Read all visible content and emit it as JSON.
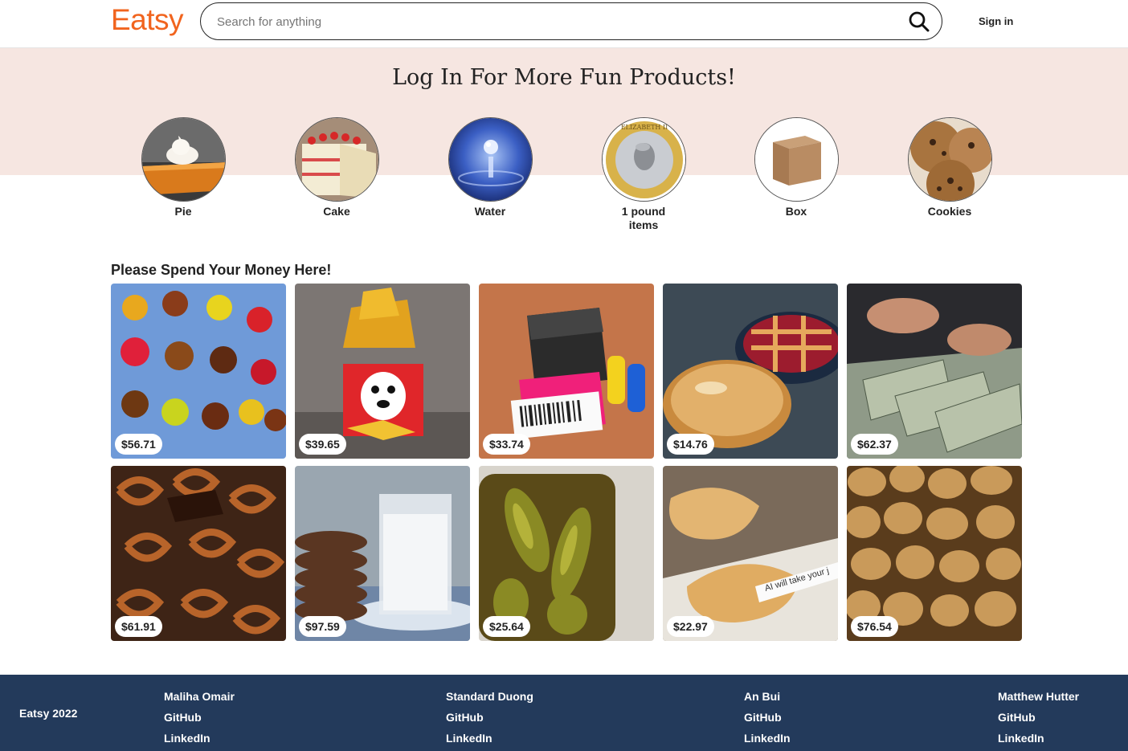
{
  "header": {
    "logo": "Eatsy",
    "search_placeholder": "Search for anything",
    "sign_in": "Sign in"
  },
  "hero": {
    "title": "Log In For More Fun Products!",
    "categories": [
      {
        "label": "Pie",
        "image": "pie-image"
      },
      {
        "label": "Cake",
        "image": "cake-image"
      },
      {
        "label": "Water",
        "image": "water-image"
      },
      {
        "label": "1 pound items",
        "image": "coin-image"
      },
      {
        "label": "Box",
        "image": "box-image"
      },
      {
        "label": "Cookies",
        "image": "cookies-image"
      }
    ]
  },
  "products": {
    "title": "Please Spend Your Money Here!",
    "items": [
      {
        "price": "$56.71",
        "image": "gummy-bears-image"
      },
      {
        "price": "$39.65",
        "image": "chips-bag-image"
      },
      {
        "price": "$33.74",
        "image": "label-printer-image"
      },
      {
        "price": "$14.76",
        "image": "pies-image"
      },
      {
        "price": "$62.37",
        "image": "cash-image"
      },
      {
        "price": "$61.91",
        "image": "pretzels-image"
      },
      {
        "price": "$97.59",
        "image": "cookies-milk-image"
      },
      {
        "price": "$25.64",
        "image": "pickles-image"
      },
      {
        "price": "$22.97",
        "image": "fortune-cookies-image",
        "caption": "AI will take your j"
      },
      {
        "price": "$76.54",
        "image": "potatoes-image"
      }
    ]
  },
  "footer": {
    "brand": "Eatsy 2022",
    "people": [
      {
        "name": "Maliha Omair",
        "github": "GitHub",
        "linkedin": "LinkedIn"
      },
      {
        "name": "Standard Duong",
        "github": "GitHub",
        "linkedin": "LinkedIn"
      },
      {
        "name": "An Bui",
        "github": "GitHub",
        "linkedin": "LinkedIn"
      },
      {
        "name": "Matthew Hutter",
        "github": "GitHub",
        "linkedin": "LinkedIn"
      }
    ]
  },
  "colors": {
    "brand": "#f1641e",
    "hero_bg": "#f6e6e1",
    "footer_bg": "#233a5b"
  }
}
